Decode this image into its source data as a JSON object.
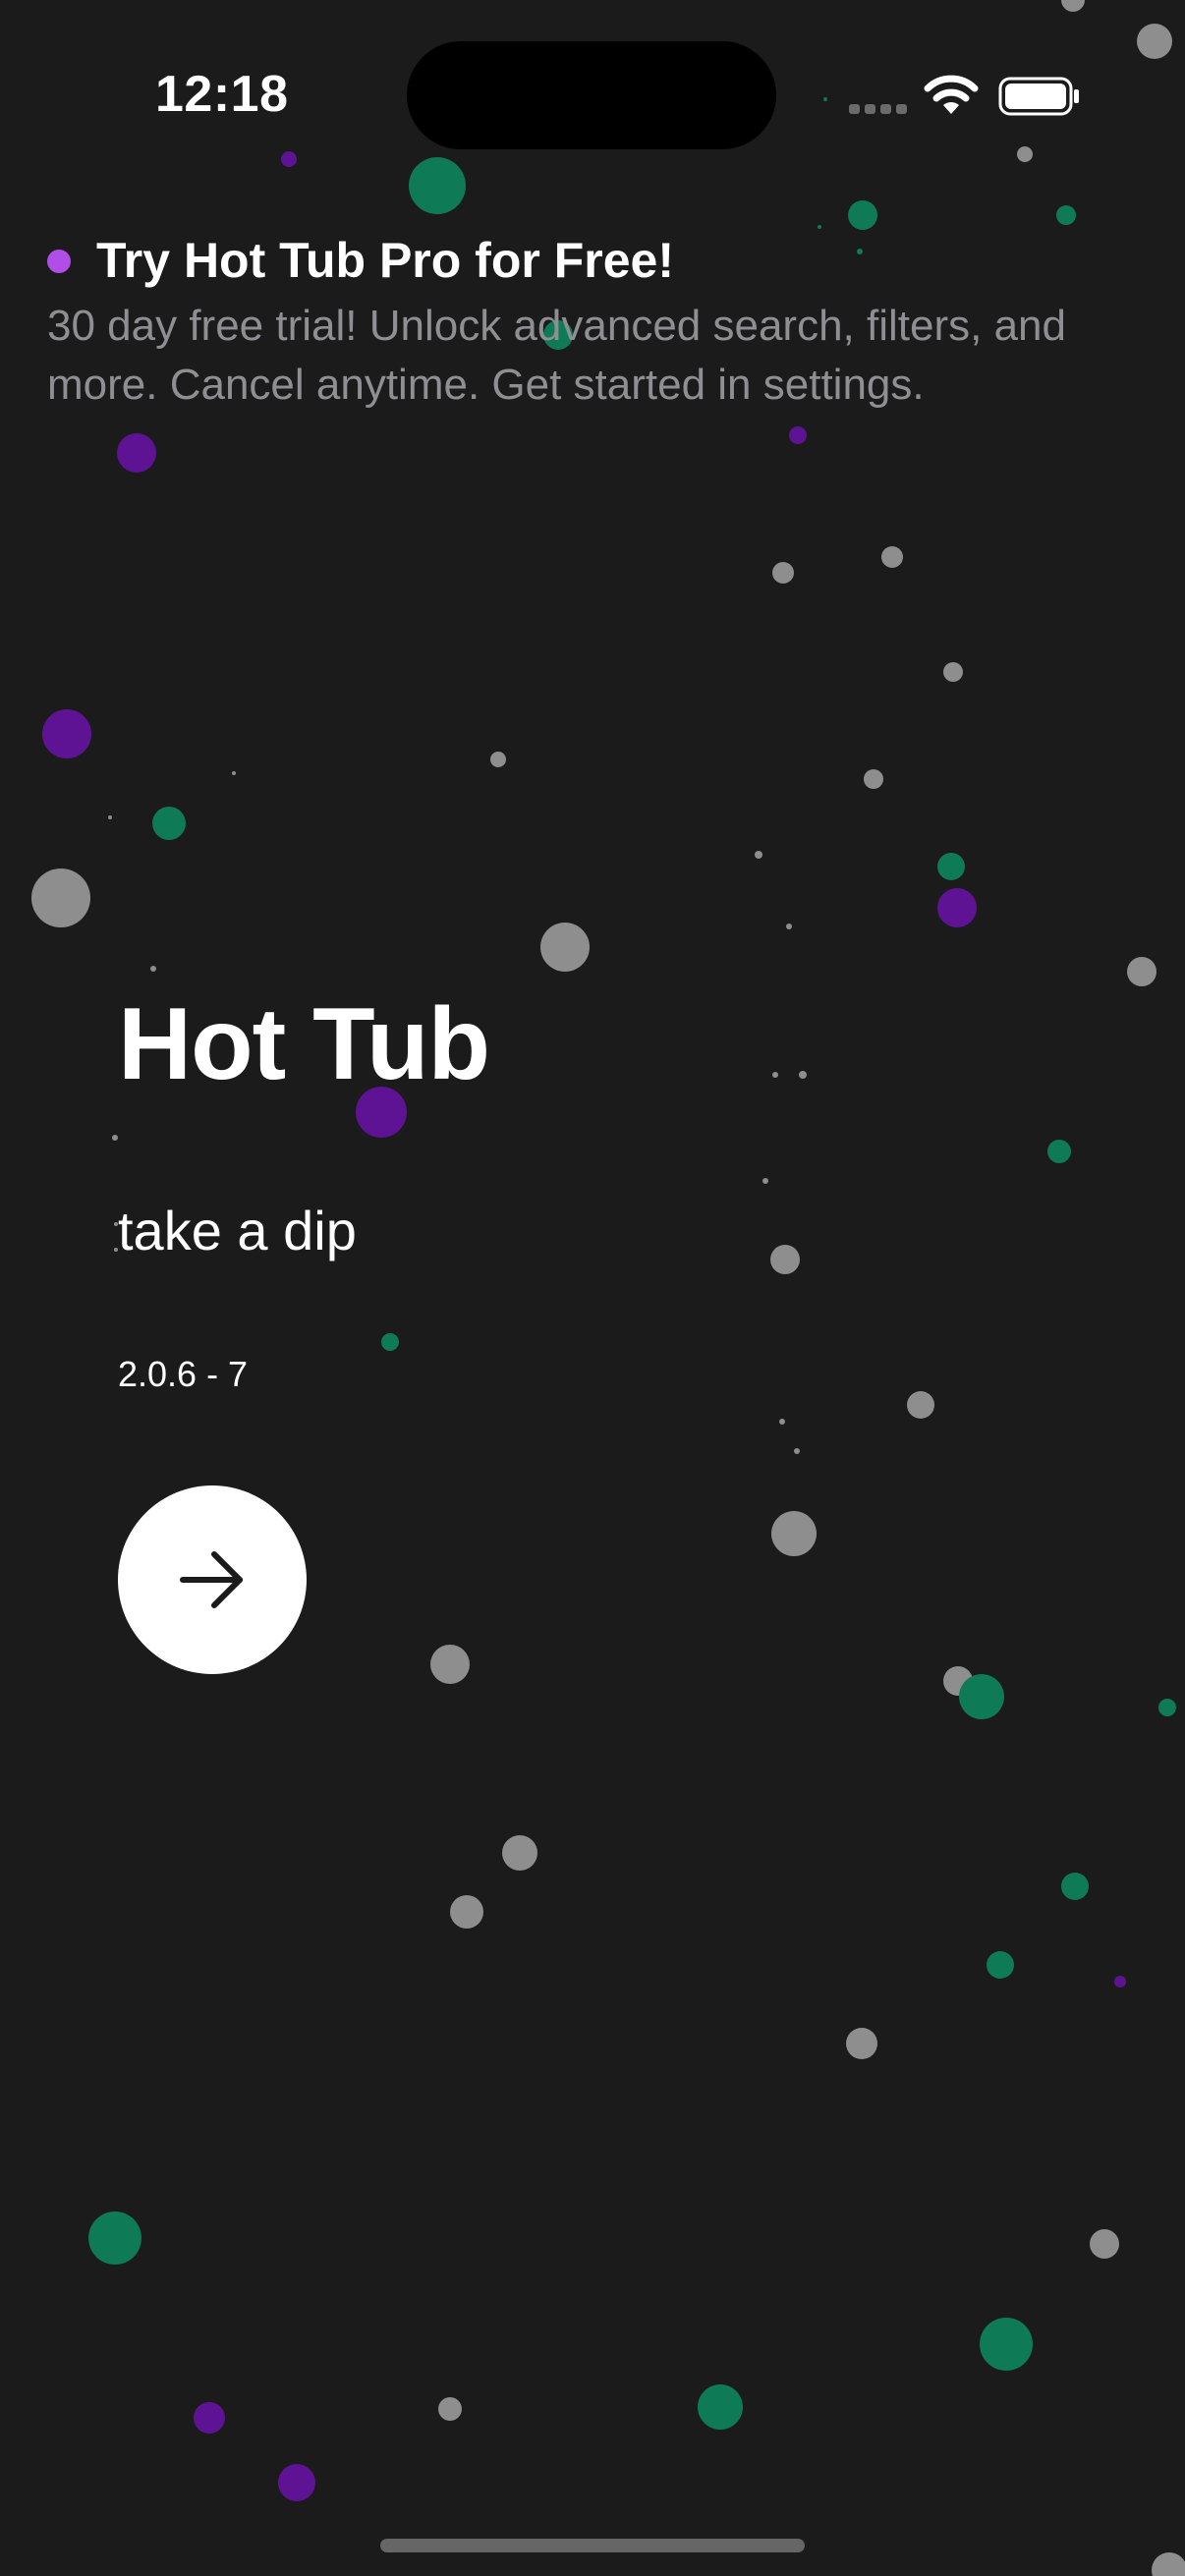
{
  "status_bar": {
    "time": "12:18",
    "icons": [
      "cellular-signal-icon",
      "wifi-icon",
      "battery-icon"
    ]
  },
  "promo": {
    "title": "Try Hot Tub Pro for Free!",
    "body": "30 day free trial! Unlock advanced search, filters, and more. Cancel anytime. Get started in settings.",
    "dot_color": "#b24ee8"
  },
  "main": {
    "title": "Hot Tub",
    "tagline": "take a dip",
    "version": "2.0.6 - 7",
    "continue_icon": "arrow-right-icon"
  },
  "colors": {
    "background": "#1b1b1b",
    "bubble_gray": "#8e8e8e",
    "bubble_green": "#0e7a56",
    "bubble_purple": "#5e1394"
  }
}
